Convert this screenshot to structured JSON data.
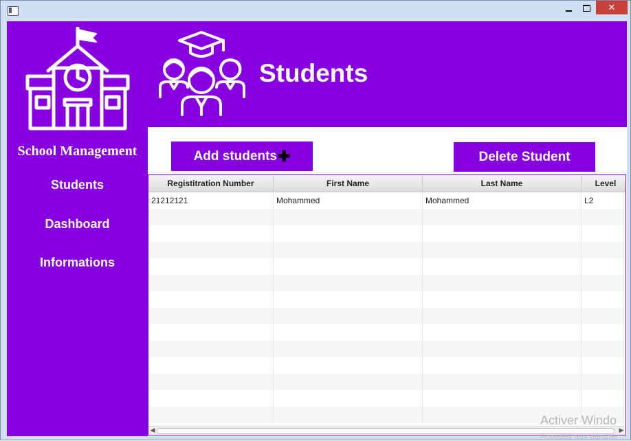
{
  "window": {
    "close_glyph": "✕"
  },
  "sidebar": {
    "brand": "School Management",
    "items": [
      {
        "label": "Students"
      },
      {
        "label": "Dashboard"
      },
      {
        "label": "Informations"
      }
    ]
  },
  "banner": {
    "title": "Students"
  },
  "actions": {
    "add_label": "Add students",
    "add_icon": "✚",
    "delete_label": "Delete Student"
  },
  "table": {
    "columns": [
      "Registitration Number",
      "First Name",
      "Last Name",
      "Level"
    ],
    "rows": [
      [
        "21212121",
        "Mohammed",
        "Mohammed",
        "L2"
      ]
    ]
  },
  "watermark": {
    "line1": "Activer Windo",
    "line2": "Accédez aux paramè"
  },
  "colors": {
    "accent": "#8600e0",
    "close": "#c7413a"
  },
  "icons": {
    "window": [
      "app-icon",
      "minimize-icon",
      "maximize-icon",
      "close-icon"
    ],
    "sidebar": [
      "school-building-icon"
    ],
    "banner": [
      "students-group-icon"
    ],
    "actions": [
      "plus-icon"
    ]
  }
}
